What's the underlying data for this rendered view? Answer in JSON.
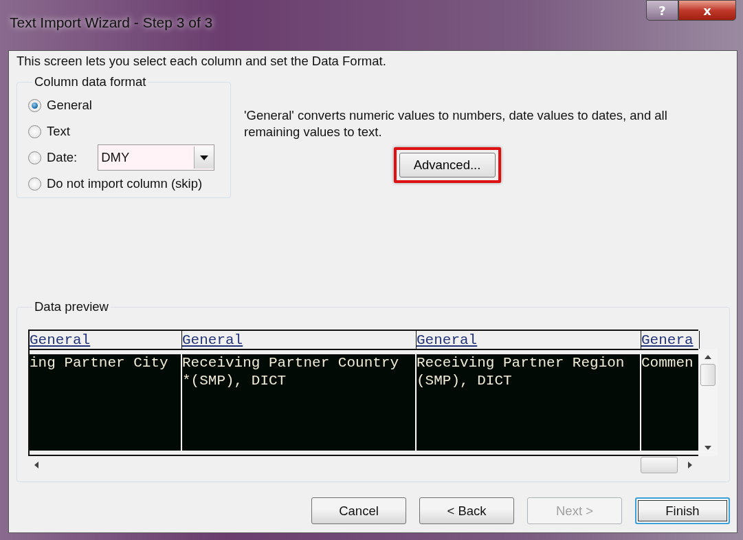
{
  "window": {
    "title": "Text Import Wizard - Step 3 of 3",
    "help_button": "?",
    "close_button": "x"
  },
  "intro": "This screen lets you select each column and set the Data Format.",
  "column_data_format": {
    "legend": "Column data format",
    "options": [
      {
        "label": "General",
        "selected": true,
        "kind": "radio"
      },
      {
        "label": "Text",
        "selected": false,
        "kind": "radio"
      },
      {
        "label": "Date:",
        "selected": false,
        "kind": "dropdown",
        "value": "DMY"
      },
      {
        "label": "Do not import column (skip)",
        "selected": false,
        "kind": "radio"
      }
    ]
  },
  "description": "'General' converts numeric values to numbers, date values to dates, and all remaining values to text.",
  "advanced_button": {
    "label": "Advanced...",
    "highlighted": true
  },
  "data_preview": {
    "legend": "Data preview",
    "columns": [
      {
        "header": "General",
        "lines": [
          "ing Partner City"
        ],
        "selected": true
      },
      {
        "header": "General",
        "lines": [
          "Receiving Partner Country",
          "*(SMP), DICT"
        ],
        "selected": true
      },
      {
        "header": "General",
        "lines": [
          "Receiving Partner Region",
          "(SMP), DICT"
        ],
        "selected": true
      },
      {
        "header": "Genera",
        "lines": [
          "Commen"
        ],
        "selected": true
      }
    ]
  },
  "buttons": [
    {
      "label": "Cancel",
      "disabled": false,
      "default": false
    },
    {
      "label": "< Back",
      "disabled": false,
      "default": false
    },
    {
      "label": "Next >",
      "disabled": true,
      "default": false
    },
    {
      "label": "Finish",
      "disabled": false,
      "default": true
    }
  ]
}
